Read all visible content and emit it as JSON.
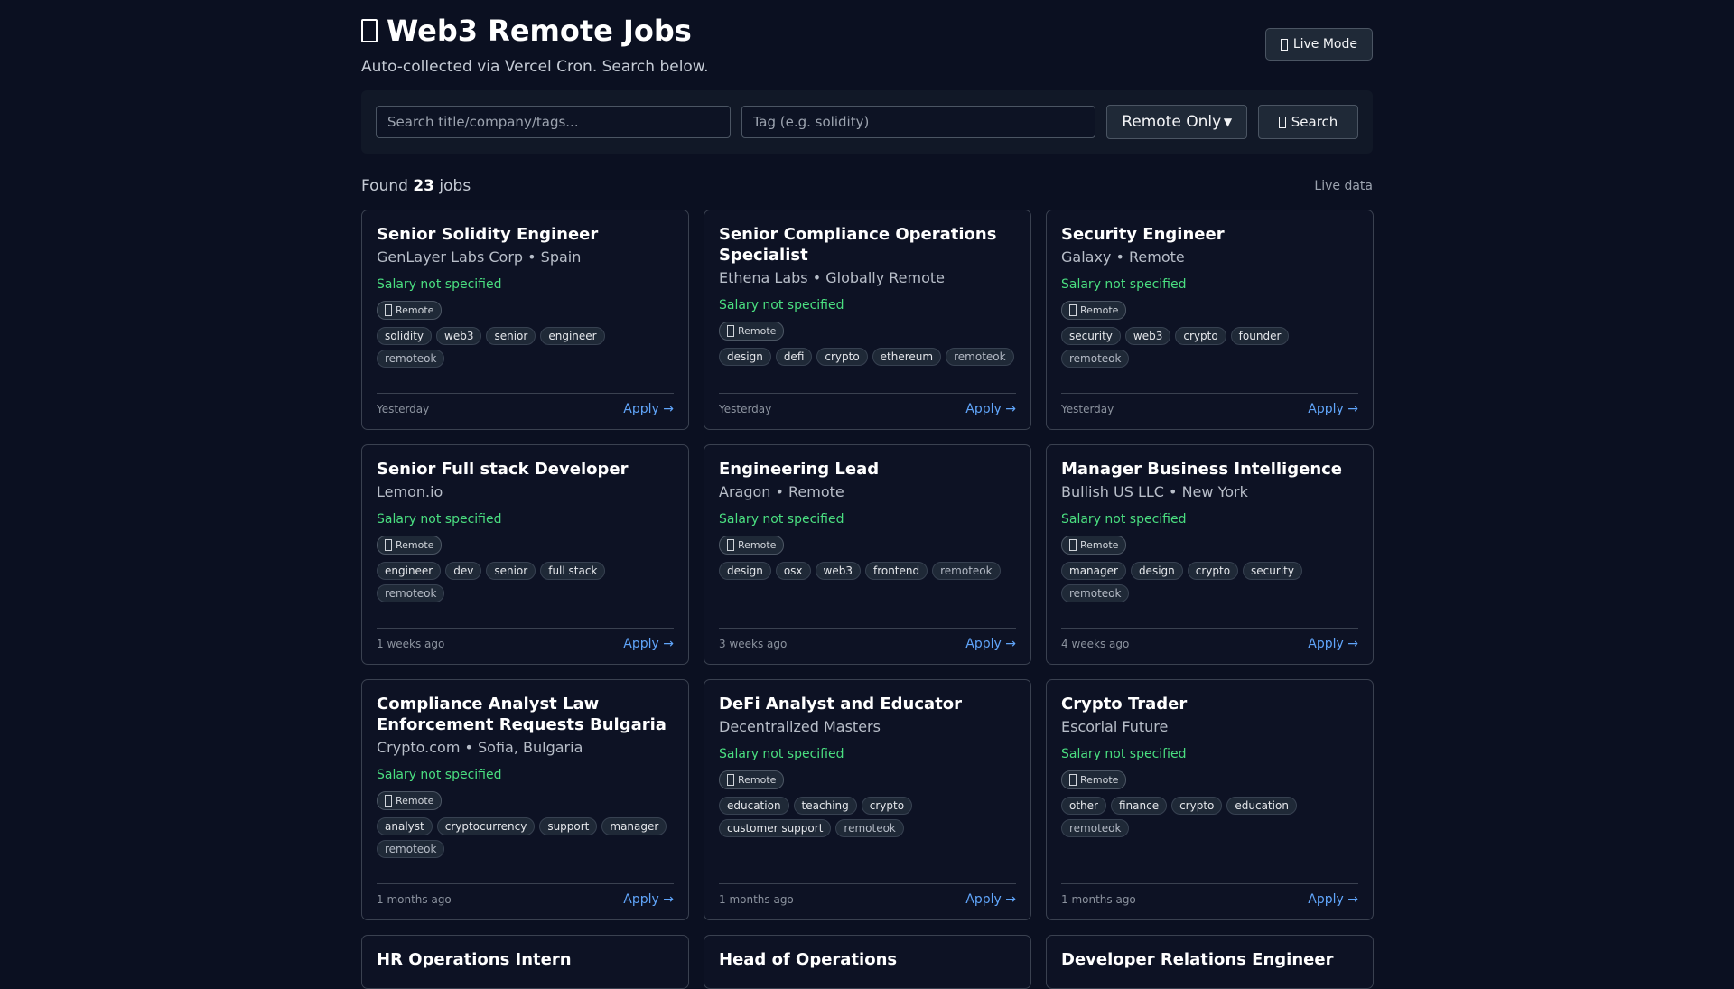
{
  "header": {
    "title": "Web3 Remote Jobs",
    "subtitle": "Auto-collected via Vercel Cron. Search below.",
    "live_mode_label": "Live Mode"
  },
  "search": {
    "query_placeholder": "Search title/company/tags...",
    "tag_placeholder": "Tag (e.g. solidity)",
    "filter_value": "Remote Only",
    "search_label": "Search"
  },
  "results": {
    "found_prefix": "Found",
    "count": "23",
    "found_suffix": "jobs",
    "source_label": "Live data"
  },
  "colors": {
    "background": "#0b1021",
    "salary": "#4ade80",
    "apply_link": "#60a5fa"
  },
  "jobs": [
    {
      "title": "Senior Solidity Engineer",
      "company_line": "GenLayer Labs Corp • Spain",
      "salary": "Salary not specified",
      "badge": "Remote",
      "tags": [
        "solidity",
        "web3",
        "senior",
        "engineer",
        "remoteok"
      ],
      "posted": "Yesterday",
      "apply": "Apply →"
    },
    {
      "title": "Senior Compliance Operations Specialist",
      "company_line": "Ethena Labs • Globally Remote",
      "salary": "Salary not specified",
      "badge": "Remote",
      "tags": [
        "design",
        "defi",
        "crypto",
        "ethereum",
        "remoteok"
      ],
      "posted": "Yesterday",
      "apply": "Apply →"
    },
    {
      "title": "Security Engineer",
      "company_line": "Galaxy • Remote",
      "salary": "Salary not specified",
      "badge": "Remote",
      "tags": [
        "security",
        "web3",
        "crypto",
        "founder",
        "remoteok"
      ],
      "posted": "Yesterday",
      "apply": "Apply →"
    },
    {
      "title": "Senior Full stack Developer",
      "company_line": "Lemon.io",
      "salary": "Salary not specified",
      "badge": "Remote",
      "tags": [
        "engineer",
        "dev",
        "senior",
        "full stack",
        "remoteok"
      ],
      "posted": "1 weeks ago",
      "apply": "Apply →"
    },
    {
      "title": "Engineering Lead",
      "company_line": "Aragon • Remote",
      "salary": "Salary not specified",
      "badge": "Remote",
      "tags": [
        "design",
        "osx",
        "web3",
        "frontend",
        "remoteok"
      ],
      "posted": "3 weeks ago",
      "apply": "Apply →"
    },
    {
      "title": "Manager Business Intelligence",
      "company_line": "Bullish US LLC • New York",
      "salary": "Salary not specified",
      "badge": "Remote",
      "tags": [
        "manager",
        "design",
        "crypto",
        "security",
        "remoteok"
      ],
      "posted": "4 weeks ago",
      "apply": "Apply →"
    },
    {
      "title": "Compliance Analyst Law Enforcement Requests Bulgaria",
      "company_line": "Crypto.com • Sofia, Bulgaria",
      "salary": "Salary not specified",
      "badge": "Remote",
      "tags": [
        "analyst",
        "cryptocurrency",
        "support",
        "manager",
        "remoteok"
      ],
      "posted": "1 months ago",
      "apply": "Apply →"
    },
    {
      "title": "DeFi Analyst and Educator",
      "company_line": "Decentralized Masters",
      "salary": "Salary not specified",
      "badge": "Remote",
      "tags": [
        "education",
        "teaching",
        "crypto",
        "customer support",
        "remoteok"
      ],
      "posted": "1 months ago",
      "apply": "Apply →"
    },
    {
      "title": "Crypto Trader",
      "company_line": "Escorial Future",
      "salary": "Salary not specified",
      "badge": "Remote",
      "tags": [
        "other",
        "finance",
        "crypto",
        "education",
        "remoteok"
      ],
      "posted": "1 months ago",
      "apply": "Apply →"
    },
    {
      "title": "HR Operations Intern"
    },
    {
      "title": "Head of Operations"
    },
    {
      "title": "Developer Relations Engineer"
    }
  ]
}
